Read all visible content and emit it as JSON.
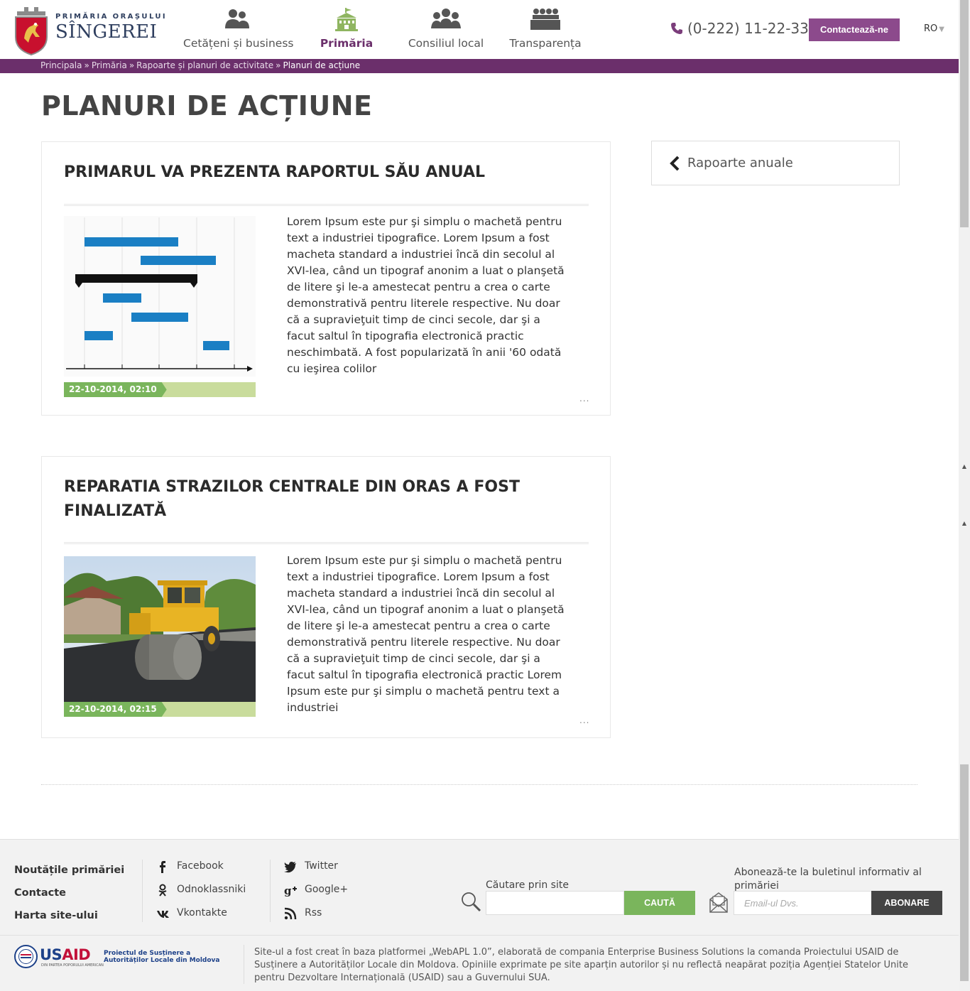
{
  "header": {
    "logo": {
      "top_text": "PRIMĂRIA ORAȘULUI",
      "name": "SÎNGEREI"
    },
    "nav": [
      {
        "label": "Cetățeni și business",
        "icon": "people-icon"
      },
      {
        "label": "Primăria",
        "icon": "town-hall-icon"
      },
      {
        "label": "Consiliul local",
        "icon": "council-icon"
      },
      {
        "label": "Transparența",
        "icon": "meeting-icon"
      }
    ],
    "phone": "(0-222) 11-22-33",
    "contact_button": "Contactează-ne",
    "language": "RO",
    "colors": {
      "brand": "#6b2f6b",
      "button": "#8c4a8c",
      "accent_green": "#7ab55c"
    }
  },
  "breadcrumb": {
    "items": [
      "Principala",
      "Primăria",
      "Rapoarte și planuri de activitate"
    ],
    "separator": "»",
    "current": "Planuri de acțiune"
  },
  "page": {
    "title": "PLANURI DE ACȚIUNE"
  },
  "articles": [
    {
      "title": "PRIMARUL VA PREZENTA RAPORTUL SĂU ANUAL",
      "image": "gantt-chart-image",
      "text": "Lorem Ipsum este pur şi simplu o machetă pentru text a industriei tipografice. Lorem Ipsum a fost macheta standard a industriei încă din secolul al XVI-lea, când un tipograf anonim a luat o planşetă de litere şi le-a amestecat pentru a crea o carte demonstrativă pentru literele respective. Nu doar că a supravieţuit timp de cinci secole, dar şi a facut saltul în tipografia electronică practic neschimbată. A fost popularizată în anii '60 odată cu ieşirea colilor",
      "date": "22-10-2014, 02:10",
      "more": "..."
    },
    {
      "title": "REPARATIA STRAZILOR CENTRALE DIN ORAS A FOST FINALIZATĂ",
      "image": "road-roller-photo",
      "text": "Lorem Ipsum este pur şi simplu o machetă pentru text a industriei tipografice. Lorem Ipsum a fost macheta standard a industriei încă din secolul al XVI-lea, când un tipograf anonim a luat o planşetă de litere şi le-a amestecat pentru a crea o carte demonstrativă pentru literele respective. Nu doar că a supravieţuit timp de cinci secole, dar şi a facut saltul în tipografia electronică practic  Lorem Ipsum este pur şi simplu o machetă pentru text a industriei",
      "date": "22-10-2014, 02:15",
      "more": "..."
    }
  ],
  "sidebar": {
    "back_link": "Rapoarte anuale"
  },
  "footer": {
    "links": [
      "Noutățile primăriei",
      "Contacte",
      "Harta site-ului"
    ],
    "social_left": [
      {
        "label": "Facebook",
        "icon": "facebook-icon"
      },
      {
        "label": "Odnoklassniki",
        "icon": "odnoklassniki-icon"
      },
      {
        "label": "Vkontakte",
        "icon": "vkontakte-icon"
      }
    ],
    "social_right": [
      {
        "label": "Twitter",
        "icon": "twitter-icon"
      },
      {
        "label": "Google+",
        "icon": "google-plus-icon"
      },
      {
        "label": "Rss",
        "icon": "rss-icon"
      }
    ],
    "search": {
      "label": "Căutare prin site",
      "value": "",
      "button": "CAUTĂ"
    },
    "newsletter": {
      "label": "Abonează-te la buletinul informativ al primăriei",
      "placeholder": "Email-ul Dvs.",
      "button": "ABONARE"
    },
    "usaid": {
      "word_us": "US",
      "word_aid": "AID",
      "sub": "DIN PARTEA POPORULUI AMERICAN",
      "project": "Proiectul de Susținere a Autorităților Locale din Moldova"
    },
    "disclaimer": "Site-ul a fost creat în baza platformei „WebAPL 1.0”, elaborată de compania Enterprise Business Solutions la comanda Proiectului USAID de Susținere a Autorităților Locale din Moldova. Opiniile exprimate pe site aparțin autorilor și nu reflectă neapărat poziția Agenției Statelor Unite pentru Dezvoltare Internațională (USAID) sau a Guvernului SUA."
  }
}
